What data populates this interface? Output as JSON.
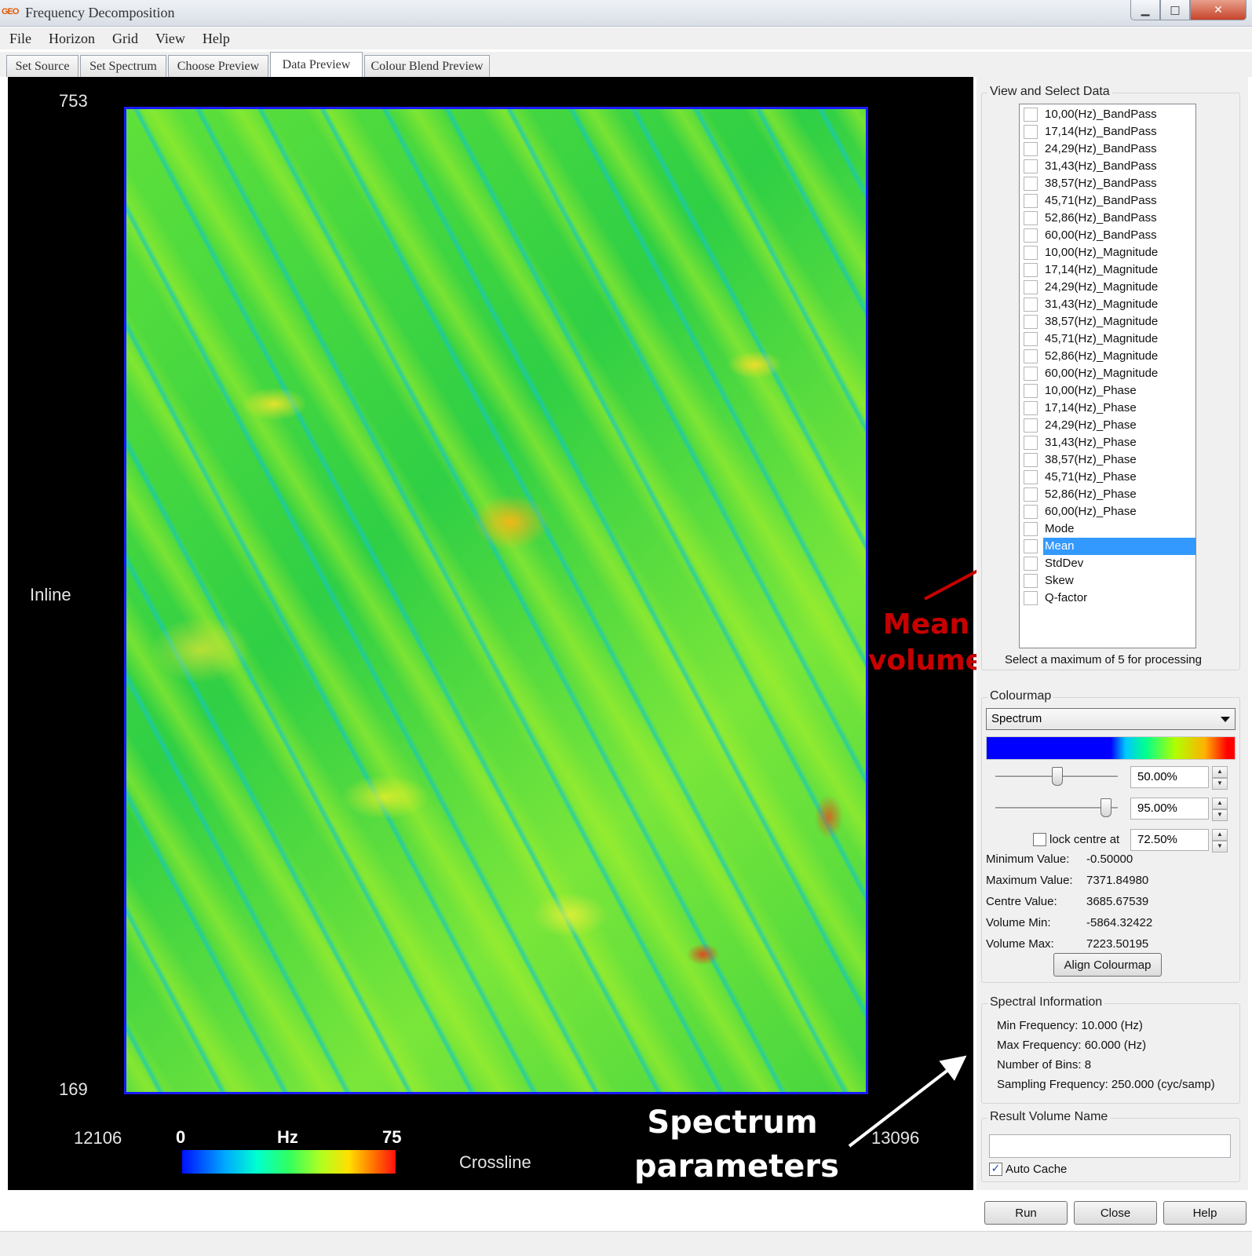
{
  "window": {
    "title": "Frequency Decomposition",
    "icon_text": "GEO",
    "controls": {
      "minimize": "▁",
      "maximize": "□",
      "close": "✕"
    }
  },
  "menu": [
    "File",
    "Horizon",
    "Grid",
    "View",
    "Help"
  ],
  "tabs": [
    "Set Source",
    "Set Spectrum",
    "Choose Preview",
    "Data Preview",
    "Colour Blend Preview"
  ],
  "active_tab": "Data Preview",
  "plot": {
    "inline_max": "753",
    "inline_min": "169",
    "inline_label": "Inline",
    "crossline_min": "12106",
    "crossline_max": "13096",
    "crossline_label": "Crossline",
    "colorbar": {
      "min_label": "0",
      "unit_label": "Hz",
      "max_label": "75"
    }
  },
  "annotations": {
    "mean_volume_line1": "Mean",
    "mean_volume_line2": "volume",
    "spectrum_params_line1": "Spectrum",
    "spectrum_params_line2": "parameters"
  },
  "view_select": {
    "title": "View and Select Data",
    "items": [
      "10,00(Hz)_BandPass",
      "17,14(Hz)_BandPass",
      "24,29(Hz)_BandPass",
      "31,43(Hz)_BandPass",
      "38,57(Hz)_BandPass",
      "45,71(Hz)_BandPass",
      "52,86(Hz)_BandPass",
      "60,00(Hz)_BandPass",
      "10,00(Hz)_Magnitude",
      "17,14(Hz)_Magnitude",
      "24,29(Hz)_Magnitude",
      "31,43(Hz)_Magnitude",
      "38,57(Hz)_Magnitude",
      "45,71(Hz)_Magnitude",
      "52,86(Hz)_Magnitude",
      "60,00(Hz)_Magnitude",
      "10,00(Hz)_Phase",
      "17,14(Hz)_Phase",
      "24,29(Hz)_Phase",
      "31,43(Hz)_Phase",
      "38,57(Hz)_Phase",
      "45,71(Hz)_Phase",
      "52,86(Hz)_Phase",
      "60,00(Hz)_Phase",
      "Mode",
      "Mean",
      "StdDev",
      "Skew",
      "Q-factor"
    ],
    "selected_item": "Mean",
    "note": "Select a maximum of 5 for processing"
  },
  "colourmap": {
    "title": "Colourmap",
    "selected": "Spectrum",
    "slider1_value": "50.00%",
    "slider2_value": "95.00%",
    "lock_centre_label": "lock centre at",
    "lock_centre_value": "72.50%",
    "stats": [
      {
        "label": "Minimum Value:",
        "value": "-0.50000"
      },
      {
        "label": "Maximum Value:",
        "value": "7371.84980"
      },
      {
        "label": "Centre Value:",
        "value": "3685.67539"
      },
      {
        "label": "Volume Min:",
        "value": "-5864.32422"
      },
      {
        "label": "Volume Max:",
        "value": "7223.50195"
      }
    ],
    "align_button": "Align Colourmap"
  },
  "spectral_info": {
    "title": "Spectral Information",
    "rows": [
      {
        "label": "Min Frequency:",
        "value": "10.000 (Hz)"
      },
      {
        "label": "Max Frequency:",
        "value": "60.000 (Hz)"
      },
      {
        "label": "Number of Bins:",
        "value": "8"
      },
      {
        "label": "Sampling Frequency:",
        "value": "250.000 (cyc/samp)"
      }
    ]
  },
  "result_volume": {
    "title": "Result Volume Name",
    "value": "",
    "auto_cache_label": "Auto Cache",
    "auto_cache_checked": true
  },
  "buttons": {
    "run": "Run",
    "close": "Close",
    "help": "Help"
  }
}
